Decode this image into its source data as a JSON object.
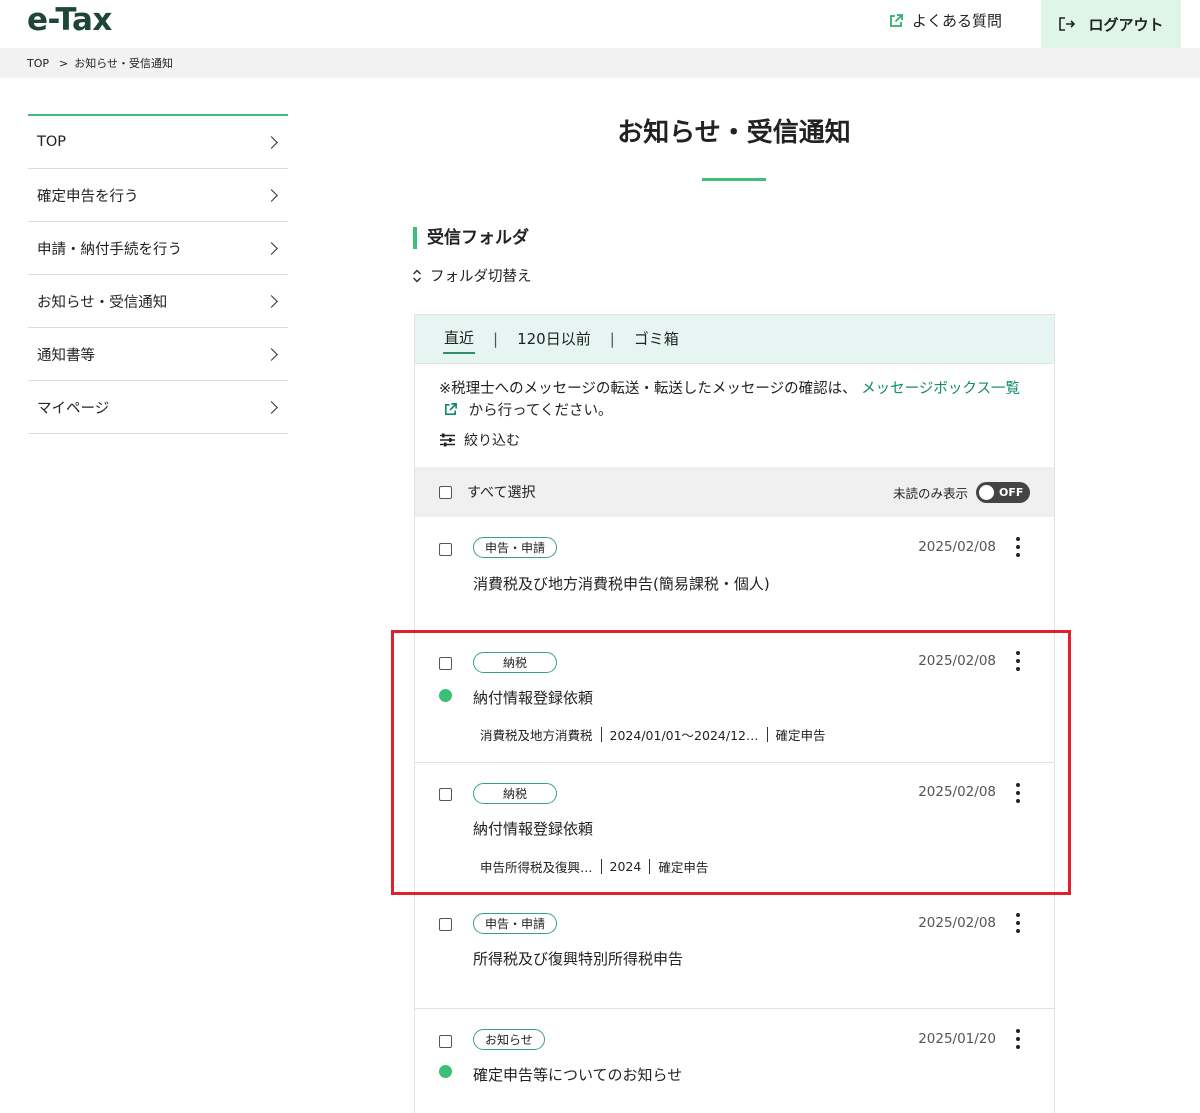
{
  "header": {
    "logo": "e-Tax",
    "faq_label": "よくある質問",
    "logout_label": "ログアウト"
  },
  "breadcrumb": {
    "home": "TOP",
    "separator": ">",
    "current": "お知らせ・受信通知"
  },
  "sidebar": {
    "items": [
      {
        "label": "TOP"
      },
      {
        "label": "確定申告を行う"
      },
      {
        "label": "申請・納付手続を行う"
      },
      {
        "label": "お知らせ・受信通知"
      },
      {
        "label": "通知書等"
      },
      {
        "label": "マイページ"
      }
    ]
  },
  "main": {
    "title": "お知らせ・受信通知",
    "section_title": "受信フォルダ",
    "folder_switch": "フォルダ切替え",
    "tabs": [
      {
        "label": "直近",
        "active": true
      },
      {
        "label": "120日以前",
        "active": false
      },
      {
        "label": "ゴミ箱",
        "active": false
      }
    ],
    "tab_separator": "|",
    "notice_prefix": "※税理士へのメッセージの転送・転送したメッセージの確認は、",
    "notice_link": "メッセージボックス一覧",
    "notice_suffix": "から行ってください。",
    "filter_label": "絞り込む",
    "select_all_label": "すべて選択",
    "unread_only_label": "未読のみ表示",
    "unread_toggle": "OFF"
  },
  "messages": [
    {
      "tag": "申告・申請",
      "date": "2025/02/08",
      "subject": "消費税及び地方消費税申告(簡易課税・個人)",
      "unread": false,
      "meta": []
    },
    {
      "tag": "納税",
      "date": "2025/02/08",
      "subject": "納付情報登録依頼",
      "unread": true,
      "meta": [
        "消費税及地方消費税",
        "2024/01/01～2024/12…",
        "確定申告"
      ]
    },
    {
      "tag": "納税",
      "date": "2025/02/08",
      "subject": "納付情報登録依頼",
      "unread": false,
      "meta": [
        "申告所得税及復興…",
        "2024",
        "確定申告"
      ]
    },
    {
      "tag": "申告・申請",
      "date": "2025/02/08",
      "subject": "所得税及び復興特別所得税申告",
      "unread": false,
      "meta": []
    },
    {
      "tag": "お知らせ",
      "date": "2025/01/20",
      "subject": "確定申告等についてのお知らせ",
      "unread": true,
      "meta": []
    }
  ],
  "colors": {
    "accent_green": "#3cbf76",
    "link_green": "#138a6b",
    "tab_bar_bg": "#e6f5f1",
    "logout_bg": "#dff5e8",
    "highlight_red": "#e0202a"
  }
}
